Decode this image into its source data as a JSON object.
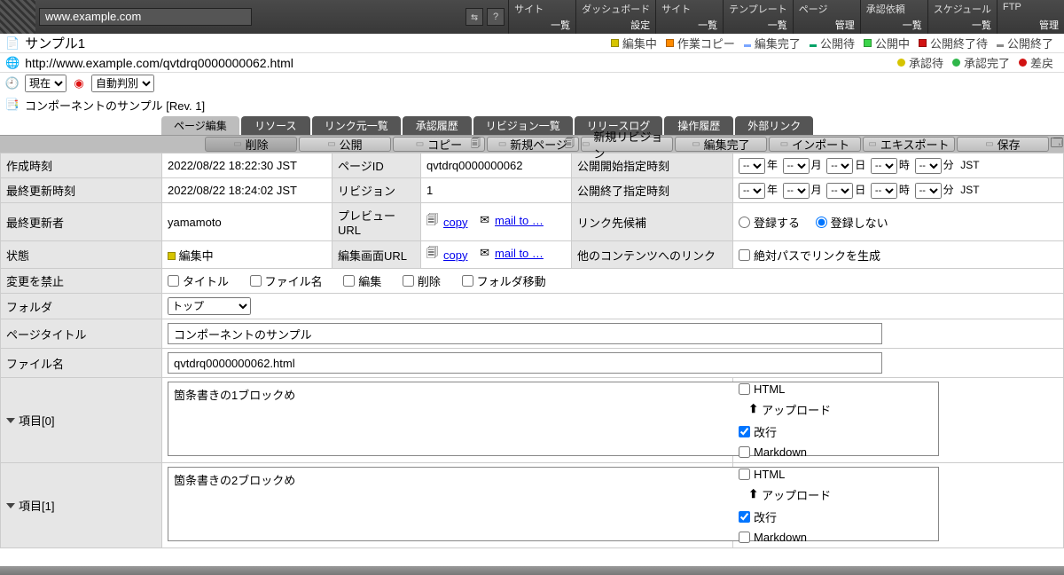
{
  "header": {
    "url": "www.example.com",
    "menu": [
      {
        "l1": "サイト",
        "l2": "一覧"
      },
      {
        "l1": "ダッシュボード",
        "l2": "設定"
      },
      {
        "l1": "サイト",
        "l2": "一覧"
      },
      {
        "l1": "テンプレート",
        "l2": "一覧"
      },
      {
        "l1": "ページ",
        "l2": "管理"
      },
      {
        "l1": "承認依頼",
        "l2": "一覧"
      },
      {
        "l1": "スケジュール",
        "l2": "一覧"
      },
      {
        "l1": "FTP",
        "l2": "管理"
      }
    ]
  },
  "legend1": [
    {
      "c": "#d6c400",
      "t": "編集中"
    },
    {
      "c": "#ff8a00",
      "t": "作業コピー"
    },
    {
      "c": "#7aa6ff",
      "t": "編集完了"
    },
    {
      "c": "#00a368",
      "t": "公開待"
    },
    {
      "c": "#3cd44a",
      "t": "公開中"
    },
    {
      "c": "#d11313",
      "t": "公開終了待"
    },
    {
      "c": "#8a8a8a",
      "t": "公開終了"
    }
  ],
  "legend2": [
    {
      "c": "#d6c400",
      "t": "承認待"
    },
    {
      "c": "#2fb64a",
      "t": "承認完了"
    },
    {
      "c": "#d11313",
      "t": "差戻"
    }
  ],
  "page": {
    "title": "サンプル1",
    "url": "http://www.example.com/qvtdrq0000000062.html",
    "timesel": "現在",
    "autosel": "自動判別",
    "component": "コンポーネントのサンプル [Rev. 1]"
  },
  "tabs": [
    "ページ編集",
    "リソース",
    "リンク元一覧",
    "承認履歴",
    "リビジョン一覧",
    "リリースログ",
    "操作履歴",
    "外部リンク"
  ],
  "actions": [
    "削除",
    "公開",
    "コピー",
    "新規ページ",
    "新規リビジョン",
    "編集完了",
    "インポート",
    "エキスポート",
    "保存"
  ],
  "labels": {
    "created": "作成時刻",
    "updated": "最終更新時刻",
    "updater": "最終更新者",
    "state": "状態",
    "pageid": "ページID",
    "revision": "リビジョン",
    "previewurl": "プレビューURL",
    "editurl": "編集画面URL",
    "pubstart": "公開開始指定時刻",
    "pubend": "公開終了指定時刻",
    "linkcand": "リンク先候補",
    "otherlink": "他のコンテンツへのリンク",
    "lock": "変更を禁止",
    "folder": "フォルダ",
    "pagetitle": "ページタイトル",
    "filename": "ファイル名",
    "copy": "copy",
    "mailto": "mail to …",
    "reg_yes": "登録する",
    "reg_no": "登録しない",
    "abslink": "絶対パスでリンクを生成",
    "chk_title": "タイトル",
    "chk_file": "ファイル名",
    "chk_edit": "編集",
    "chk_del": "削除",
    "chk_move": "フォルダ移動",
    "item0": "項目[0]",
    "item1": "項目[1]",
    "html": "HTML",
    "upload": "アップロード",
    "br": "改行",
    "md": "Markdown",
    "y": "年",
    "m": "月",
    "d": "日",
    "h": "時",
    "mi": "分",
    "tz": "JST",
    "dash": "-- "
  },
  "values": {
    "created": "2022/08/22 18:22:30 JST",
    "updated": "2022/08/22 18:24:02 JST",
    "updater": "yamamoto",
    "state": "編集中",
    "pageid": "qvtdrq0000000062",
    "revision": "1",
    "folder": "トップ",
    "pagetitle": "コンポーネントのサンプル",
    "filename": "qvtdrq0000000062.html",
    "item0": "箇条書きの1ブロックめ",
    "item1": "箇条書きの2ブロックめ"
  }
}
